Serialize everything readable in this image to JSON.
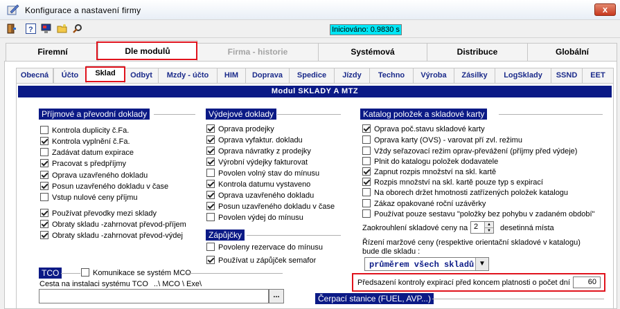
{
  "window": {
    "title": "Konfigurace a nastavení firmy",
    "close_label": "x"
  },
  "toolbar": {
    "icons": [
      "door-exit-icon",
      "help-icon",
      "monitor-icon",
      "folder-icon",
      "tools-icon"
    ],
    "init_status": "Iniciováno: 0.9830 s"
  },
  "main_tabs": [
    "Firemní",
    "Dle modulů",
    "Firma - historie",
    "Systémová",
    "Distribuce",
    "Globální"
  ],
  "sub_tabs": [
    "Obecná",
    "Účto",
    "Sklad",
    "Odbyt",
    "Mzdy - účto",
    "HIM",
    "Doprava",
    "Spedice",
    "Jízdy",
    "Techno",
    "Výroba",
    "Zásilky",
    "LogSklady",
    "SSND",
    "EET"
  ],
  "module_header": "Modul  SKLADY A MTZ",
  "incoming": {
    "title": "Příjmové a převodní doklady",
    "items": [
      {
        "label": "Kontrola duplicity  č.Fa.",
        "checked": false
      },
      {
        "label": "Kontrola vyplnění  č.Fa.",
        "checked": true
      },
      {
        "label": "Zadávat datum expirace",
        "checked": false
      },
      {
        "label": "Pracovat s předpříjmy",
        "checked": true
      },
      {
        "label": "Oprava uzavřeného dokladu",
        "checked": true
      },
      {
        "label": "Posun uzavřeného dokladu v čase",
        "checked": true
      },
      {
        "label": "Vstup nulové ceny příjmu",
        "checked": false
      }
    ],
    "transfer_items": [
      {
        "label": "Používat převodky mezi sklady",
        "checked": true
      },
      {
        "label": "Obraty skladu -zahrnovat převod-příjem",
        "checked": true
      },
      {
        "label": "Obraty skladu -zahrnovat převod-výdej",
        "checked": true
      }
    ]
  },
  "outgoing": {
    "title": "Výdejové doklady",
    "items": [
      {
        "label": "Oprava prodejky",
        "checked": true
      },
      {
        "label": "Oprava vyfaktur. dokladu",
        "checked": true
      },
      {
        "label": "Oprava návratky z prodejky",
        "checked": true
      },
      {
        "label": "Výrobní výdejky fakturovat",
        "checked": true
      },
      {
        "label": "Povolen volný stav do mínusu",
        "checked": false
      },
      {
        "label": "Kontrola datumu vystaveno",
        "checked": true
      },
      {
        "label": "Oprava uzavřeného dokladu",
        "checked": true
      },
      {
        "label": "Posun uzavřeného dokladu v čase",
        "checked": true
      },
      {
        "label": "Povolen výdej do  mínusu",
        "checked": false
      }
    ]
  },
  "loans": {
    "title": "Zápůjčky",
    "items": [
      {
        "label": "Povoleny rezervace do mínusu",
        "checked": false
      },
      {
        "label": "Používat u zápůjček semafor",
        "checked": true
      }
    ]
  },
  "catalog": {
    "title": "Katalog položek a  skladové karty",
    "items": [
      {
        "label": "Oprava poč.stavu skladové karty",
        "checked": true
      },
      {
        "label": "Oprava karty (OVS) - varovat pří zvl. režimu",
        "checked": false
      },
      {
        "label": "Vždy seřazovací režim oprav-převážení (příjmy před výdeje)",
        "checked": false
      },
      {
        "label": "Plnit do katalogu položek dodavatele",
        "checked": false
      },
      {
        "label": "Zapnut rozpis množství na skl. kartě",
        "checked": true
      },
      {
        "label": "Rozpis množství na skl. kartě pouze typ s expirací",
        "checked": true
      },
      {
        "label": "Na oborech držet hmotnosti zatřízených položek katalogu",
        "checked": false
      },
      {
        "label": "Zákaz opakované roční uzávěrky",
        "checked": false
      },
      {
        "label": "Používat pouze sestavu \"položky bez pohybu v zadaném období\"",
        "checked": false
      }
    ],
    "rounding_prefix": "Zaokrouhlení skladové ceny na",
    "rounding_value": "2",
    "rounding_suffix": "desetinná místa",
    "margin_line1": "Řízení maržové ceny (respektive orientační skladové v katalogu)",
    "margin_line2": "bude dle skladu :",
    "margin_select": "průměrem všech skladů",
    "expiry_label": "Předsazení kontroly expirací před koncem platnosti o počet dní :",
    "expiry_value": "60"
  },
  "tco": {
    "title": "TCO",
    "mco_label": "Komunikace se systém MCO",
    "mco_checked": false,
    "path_label": "Cesta na instalaci systému TCO",
    "path_hint": "..\\ MCO \\ Exe\\",
    "path_value": "",
    "browse_label": "..."
  },
  "fuel": {
    "title": "Čerpací stanice (FUEL, AVP...)"
  }
}
